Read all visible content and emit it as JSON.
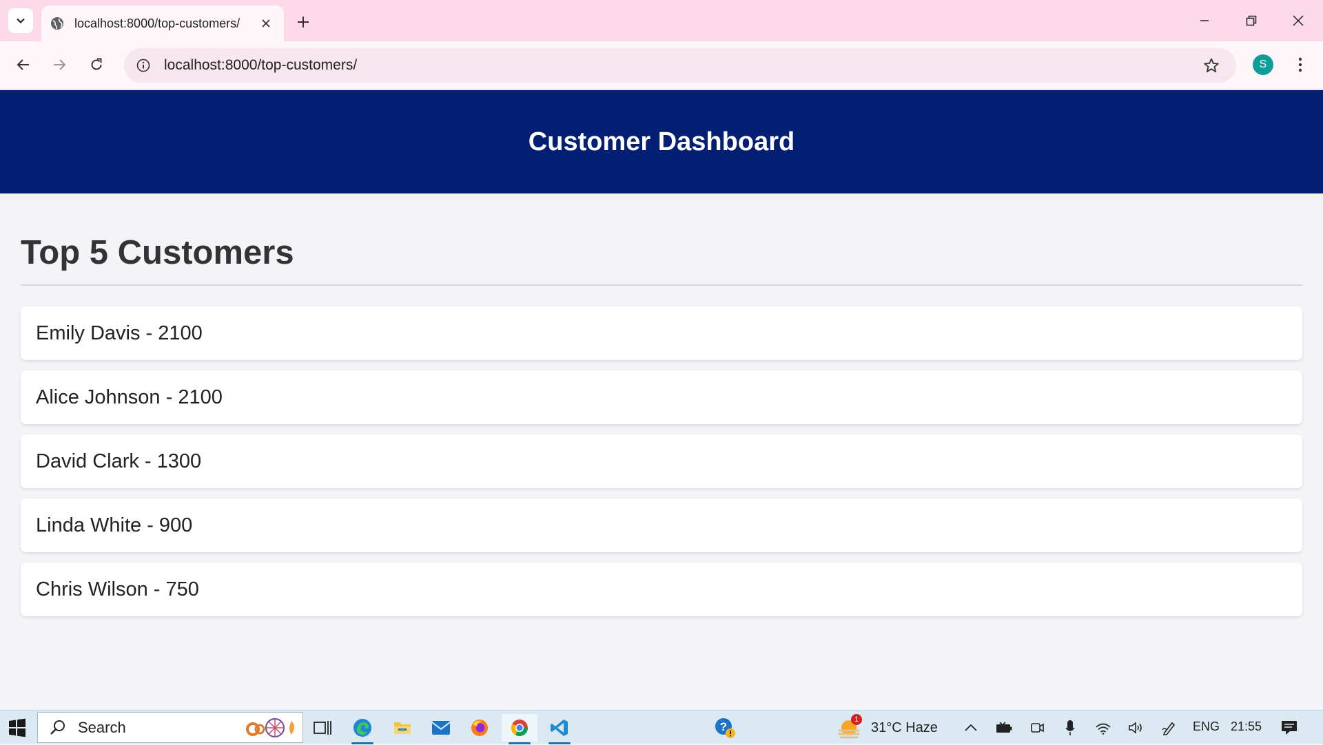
{
  "browser": {
    "tab_title": "localhost:8000/top-customers/",
    "url": "localhost:8000/top-customers/",
    "profile_initial": "S"
  },
  "page": {
    "header_title": "Customer Dashboard",
    "section_title": "Top 5 Customers",
    "customers": [
      {
        "text": "Emily Davis - 2100"
      },
      {
        "text": "Alice Johnson - 2100"
      },
      {
        "text": "David Clark - 1300"
      },
      {
        "text": "Linda White - 900"
      },
      {
        "text": "Chris Wilson - 750"
      }
    ]
  },
  "taskbar": {
    "search_placeholder": "Search",
    "weather_text": "31°C  Haze",
    "weather_badge": "1",
    "language": "ENG",
    "clock": "21:55"
  },
  "colors": {
    "header_bg": "#021f74",
    "tabstrip_bg": "#fbd9e8",
    "avatar_bg": "#0f9d9a"
  }
}
